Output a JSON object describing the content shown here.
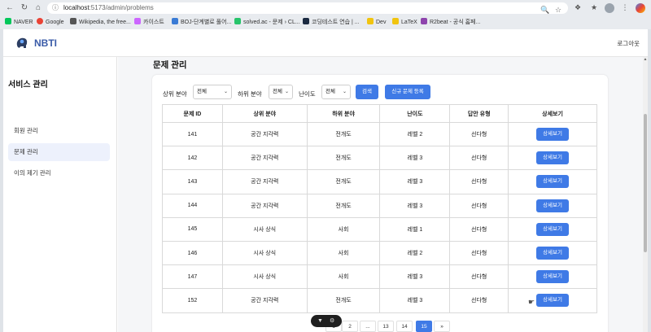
{
  "browser": {
    "url_host": "localhost",
    "url_path": ":5173/admin/problems",
    "bookmarks": [
      {
        "label": "NAVER",
        "color": "#03c75a"
      },
      {
        "label": "Google",
        "color": "#ea4335"
      },
      {
        "label": "Wikipedia, the free...",
        "color": "#555555"
      },
      {
        "label": "카이스트",
        "color": "#cc66ff"
      },
      {
        "label": "BOJ-단계별로 풀어...",
        "color": "#3a7bd5"
      },
      {
        "label": "solved.ac - 문제 › CL...",
        "color": "#27c46b"
      },
      {
        "label": "코딩테스트 연습 | ...",
        "color": "#1b2a41"
      },
      {
        "label": "Dev",
        "color": "#f1c40f"
      },
      {
        "label": "LaTeX",
        "color": "#f1c40f"
      },
      {
        "label": "R2beat - 공식 홈페...",
        "color": "#8e44ad"
      }
    ]
  },
  "header": {
    "app_name": "NBTI",
    "logout_label": "로그아웃"
  },
  "sidebar": {
    "title": "서비스 관리",
    "items": [
      {
        "label": "회원 관리",
        "active": false
      },
      {
        "label": "문제 관리",
        "active": true
      },
      {
        "label": "이의 제기 관리",
        "active": false
      }
    ]
  },
  "main": {
    "page_title": "문제 관리",
    "filters": {
      "upper_label": "상위 분야",
      "upper_value": "전체",
      "lower_label": "하위 분야",
      "lower_value": "전체",
      "difficulty_label": "난이도",
      "difficulty_value": "전체",
      "search_label": "검색",
      "new_label": "신규 문제 등록"
    },
    "table": {
      "headers": [
        "문제 ID",
        "상위 분야",
        "하위 분야",
        "난이도",
        "답안 유형",
        "상세보기"
      ],
      "detail_label": "상세보기",
      "rows": [
        [
          "141",
          "공간 지각력",
          "전개도",
          "레벨 2",
          "선다형"
        ],
        [
          "142",
          "공간 지각력",
          "전개도",
          "레벨 3",
          "선다형"
        ],
        [
          "143",
          "공간 지각력",
          "전개도",
          "레벨 3",
          "선다형"
        ],
        [
          "144",
          "공간 지각력",
          "전개도",
          "레벨 3",
          "선다형"
        ],
        [
          "145",
          "시사 상식",
          "사회",
          "레벨 1",
          "선다형"
        ],
        [
          "146",
          "시사 상식",
          "사회",
          "레벨 2",
          "선다형"
        ],
        [
          "147",
          "시사 상식",
          "사회",
          "레벨 3",
          "선다형"
        ],
        [
          "152",
          "공간 지각력",
          "전개도",
          "레벨 3",
          "선다형"
        ]
      ]
    },
    "pagination": {
      "pages": [
        "1",
        "2",
        "...",
        "13",
        "14",
        "15",
        "»"
      ],
      "current": "15"
    }
  },
  "colors": {
    "accent": "#3f7ae6",
    "brand": "#3a5ba8",
    "sidebar_active": "#edf1fc"
  }
}
